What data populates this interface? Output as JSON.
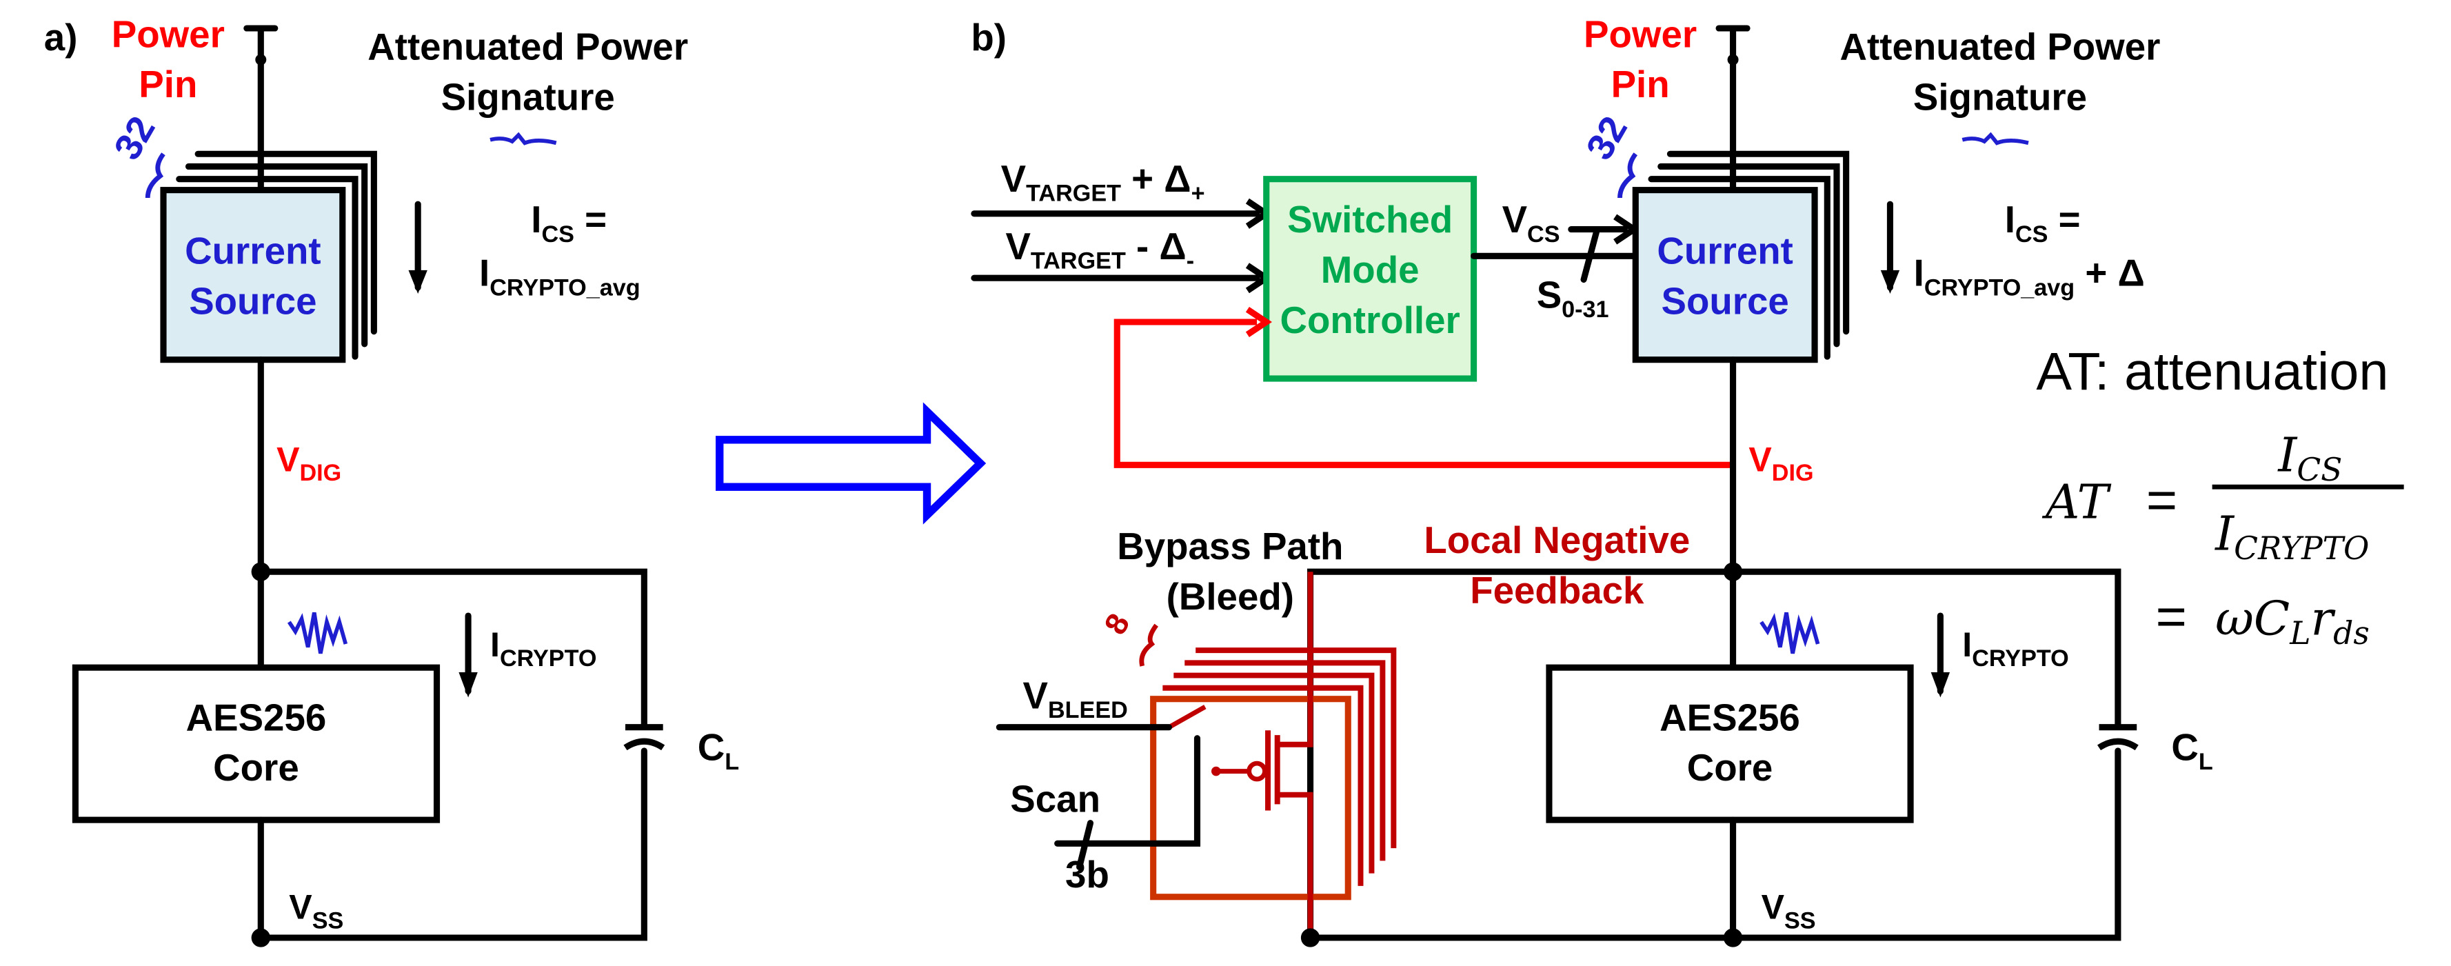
{
  "panel_a": {
    "label": "a)",
    "power_pin": [
      "Power",
      "Pin"
    ],
    "signature": [
      "Attenuated Power",
      "Signature"
    ],
    "bus_width": "32",
    "current_source": [
      "Current",
      "Source"
    ],
    "ics_line1": {
      "main": "I",
      "sub": "CS",
      "tail": " ="
    },
    "ics_line2": {
      "main": "I",
      "sub": "CRYPTO_avg",
      "tail": ""
    },
    "vdig": {
      "main": "V",
      "sub": "DIG"
    },
    "icrypto": {
      "main": "I",
      "sub": "CRYPTO"
    },
    "core": [
      "AES256",
      "Core"
    ],
    "cl": {
      "main": "C",
      "sub": "L"
    },
    "vss": {
      "main": "V",
      "sub": "SS"
    }
  },
  "panel_b": {
    "label": "b)",
    "power_pin": [
      "Power",
      "Pin"
    ],
    "signature": [
      "Attenuated Power",
      "Signature"
    ],
    "bus_width": "32",
    "current_source": [
      "Current",
      "Source"
    ],
    "ics_line1": {
      "main": "I",
      "sub": "CS",
      "tail": " ="
    },
    "ics_line2": {
      "main": "I",
      "sub": "CRYPTO_avg",
      "tail": " + Δ"
    },
    "vtarget_plus": {
      "main": "V",
      "sub": "TARGET",
      "tail": " + Δ",
      "tailsub": "+"
    },
    "vtarget_minus": {
      "main": "V",
      "sub": "TARGET",
      "tail": " - Δ",
      "tailsub": "-"
    },
    "controller": [
      "Switched",
      "Mode",
      "Controller"
    ],
    "vcs": {
      "main": "V",
      "sub": "CS"
    },
    "sbus": {
      "main": "S",
      "sub": "0-31"
    },
    "vdig": {
      "main": "V",
      "sub": "DIG"
    },
    "bypass": [
      "Bypass Path",
      "(Bleed)"
    ],
    "bypass_width": "8",
    "feedback": [
      "Local Negative",
      "Feedback"
    ],
    "vbleed": {
      "main": "V",
      "sub": "BLEED"
    },
    "scan": "Scan",
    "scan_width": "3b",
    "icrypto": {
      "main": "I",
      "sub": "CRYPTO"
    },
    "core": [
      "AES256",
      "Core"
    ],
    "cl": {
      "main": "C",
      "sub": "L"
    },
    "vss": {
      "main": "V",
      "sub": "SS"
    }
  },
  "equation": {
    "title": "AT: attenuation",
    "lhs": "AT",
    "eq": "=",
    "num": {
      "main": "I",
      "sub": "CS"
    },
    "den": {
      "main": "I",
      "sub": "CRYPTO"
    },
    "rhs2": {
      "omega": "ω",
      "c": "C",
      "csub": "L",
      "r": "r",
      "rsub": "ds"
    }
  },
  "colors": {
    "label_red": "#ff0000",
    "feedback_red": "#c00000",
    "signal_blue": "#1f1fd0",
    "controller_green": "#00a84f",
    "controller_fill": "#dff7d9",
    "source_fill": "#dbedf3",
    "bleed_orange": "#cc3300"
  }
}
